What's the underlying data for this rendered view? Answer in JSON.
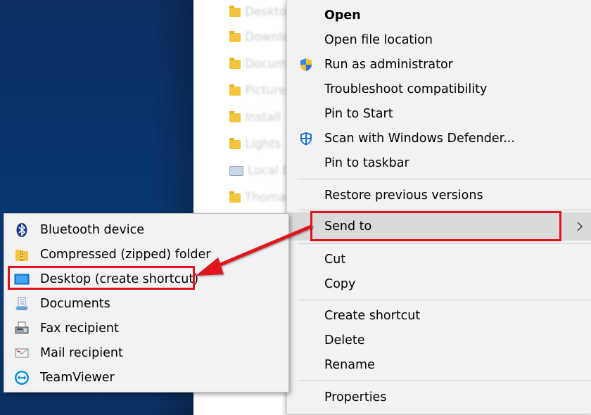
{
  "explorer": {
    "items": [
      {
        "name": "Desktop",
        "icon": "folder-icon"
      },
      {
        "name": "Downloads",
        "icon": "folder-icon"
      },
      {
        "name": "Documents",
        "icon": "folder-icon"
      },
      {
        "name": "Pictures",
        "icon": "folder-icon"
      },
      {
        "name": "Install",
        "icon": "folder-icon"
      },
      {
        "name": "Lights",
        "icon": "folder-icon"
      },
      {
        "name": "Local Disk",
        "icon": "drive-icon"
      },
      {
        "name": "Thomas",
        "icon": "folder-icon"
      }
    ]
  },
  "context_menu": {
    "open": "Open",
    "open_file_location": "Open file location",
    "run_as_admin": "Run as administrator",
    "troubleshoot": "Troubleshoot compatibility",
    "pin_to_start": "Pin to Start",
    "scan_defender": "Scan with Windows Defender...",
    "pin_to_taskbar": "Pin to taskbar",
    "restore_versions": "Restore previous versions",
    "send_to": "Send to",
    "cut": "Cut",
    "copy": "Copy",
    "create_shortcut": "Create shortcut",
    "delete": "Delete",
    "rename": "Rename",
    "properties": "Properties"
  },
  "send_to_menu": {
    "bluetooth": "Bluetooth device",
    "zip": "Compressed (zipped) folder",
    "desktop": "Desktop (create shortcut)",
    "documents": "Documents",
    "fax": "Fax recipient",
    "mail": "Mail recipient",
    "teamviewer": "TeamViewer"
  },
  "colors": {
    "annotation": "#e0141e",
    "menu_bg": "#f2f2f2",
    "hover_bg": "#dadada",
    "desktop_bg": "#0b3a76"
  }
}
